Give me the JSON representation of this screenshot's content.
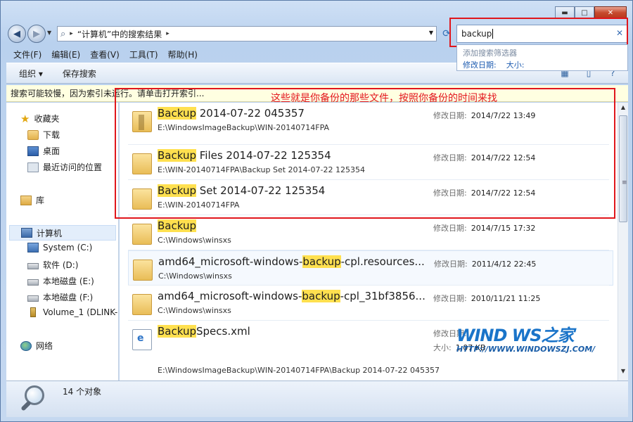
{
  "window": {
    "controls": {
      "minimize": "▬",
      "maximize": "□",
      "close": "✕"
    }
  },
  "address": {
    "separator_glyph": "▸",
    "location": "“计算机”中的搜索结果",
    "arrow": "▸"
  },
  "search": {
    "value": "backup",
    "clear_glyph": "✕",
    "hint": "添加搜索筛选器",
    "filters": [
      "修改日期:",
      "大小:"
    ]
  },
  "menu": [
    "文件(F)",
    "编辑(E)",
    "查看(V)",
    "工具(T)",
    "帮助(H)"
  ],
  "toolbar": {
    "organize": "组织 ▾",
    "save_search": "保存搜索"
  },
  "infobar": {
    "text": "搜索可能较慢，因为索引未运行。请单击打开索引..."
  },
  "nav": {
    "favorites": "收藏夹",
    "downloads": "下载",
    "desktop": "桌面",
    "recent": "最近访问的位置",
    "libraries": "库",
    "computer": "计算机",
    "drives": [
      "System (C:)",
      "软件 (D:)",
      "本地磁盘 (E:)",
      "本地磁盘 (F:)",
      "Volume_1 (DLINK-"
    ],
    "network": "网络"
  },
  "annotation": "这些就是你备份的那些文件，按照你备份的时间来找",
  "results": [
    {
      "hl": "Backup",
      "rest": " 2014-07-22 045357",
      "path": "E:\\WindowsImageBackup\\WIN-20140714FPA",
      "meta_key": "修改日期:",
      "meta_val": "2014/7/22 13:49"
    },
    {
      "hl": "Backup",
      "rest": " Files 2014-07-22 125354",
      "path": "E:\\WIN-20140714FPA\\Backup Set 2014-07-22 125354",
      "meta_key": "修改日期:",
      "meta_val": "2014/7/22 12:54"
    },
    {
      "hl": "Backup",
      "rest": " Set 2014-07-22 125354",
      "path": "E:\\WIN-20140714FPA",
      "meta_key": "修改日期:",
      "meta_val": "2014/7/22 12:54"
    },
    {
      "hl": "Backup",
      "rest": "",
      "path": "C:\\Windows\\winsxs",
      "meta_key": "修改日期:",
      "meta_val": "2014/7/15 17:32"
    },
    {
      "pre": "amd64_microsoft-windows-",
      "hl": "backup",
      "rest": "-cpl.resources...",
      "path": "C:\\Windows\\winsxs",
      "meta_key": "修改日期:",
      "meta_val": "2011/4/12 22:45"
    },
    {
      "pre": "amd64_microsoft-windows-",
      "hl": "backup",
      "rest": "-cpl_31bf3856...",
      "path": "C:\\Windows\\winsxs",
      "meta_key": "修改日期:",
      "meta_val": "2010/11/21 11:25"
    },
    {
      "hl": "Backup",
      "rest": "Specs.xml",
      "path": "E:\\WindowsImageBackup\\WIN-20140714FPA\\Backup 2014-07-22 045357",
      "meta_key": "修改日期:",
      "meta_val": "",
      "size_key": "大小:",
      "size_val": "1.07 KB"
    }
  ],
  "status": {
    "count": "14 个对象"
  },
  "watermark": {
    "logo": "WIND  WS之家",
    "url": "HTTP://WWW.WINDOWSZJ.COM/"
  }
}
